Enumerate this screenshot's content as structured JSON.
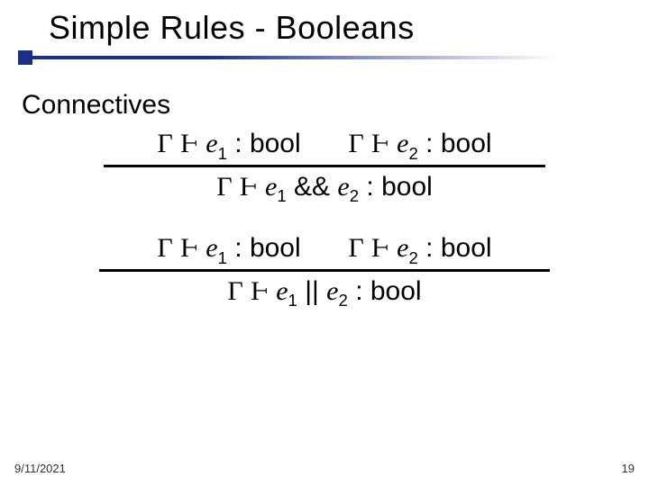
{
  "title": "Simple Rules - Booleans",
  "subhead": "Connectives",
  "symbols": {
    "gamma": "Γ",
    "turnstile": "Ⱶ",
    "var": "e",
    "type": "bool",
    "colon": ":"
  },
  "rules": [
    {
      "premises": [
        {
          "sub": "1"
        },
        {
          "sub": "2"
        }
      ],
      "conclusion": {
        "sub1": "1",
        "op": "&&",
        "sub2": "2"
      }
    },
    {
      "premises": [
        {
          "sub": "1"
        },
        {
          "sub": "2"
        }
      ],
      "conclusion": {
        "sub1": "1",
        "op": "||",
        "sub2": "2"
      }
    }
  ],
  "footer": {
    "date": "9/11/2021",
    "page": "19"
  }
}
